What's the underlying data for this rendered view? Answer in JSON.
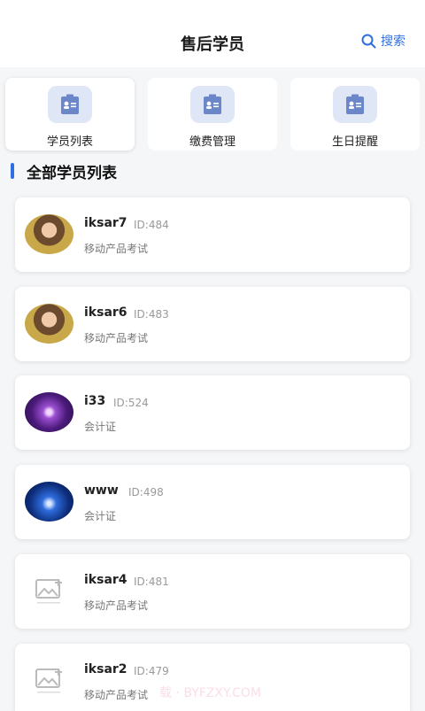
{
  "header": {
    "title": "售后学员",
    "search_label": "搜索"
  },
  "tabs": [
    {
      "label": "学员列表",
      "icon": "student-card-icon",
      "active": true
    },
    {
      "label": "缴费管理",
      "icon": "student-card-icon",
      "active": false
    },
    {
      "label": "生日提醒",
      "icon": "student-card-icon",
      "active": false
    }
  ],
  "section": {
    "title": "全部学员列表"
  },
  "students": [
    {
      "name": "iksar7",
      "id": "ID:484",
      "course": "移动产品考试",
      "avatar": "photo"
    },
    {
      "name": "iksar6",
      "id": "ID:483",
      "course": "移动产品考试",
      "avatar": "photo"
    },
    {
      "name": "i33",
      "id": "ID:524",
      "course": "会计证",
      "avatar": "galaxy"
    },
    {
      "name": "www",
      "id": "ID:498",
      "course": "会计证",
      "avatar": "blue-light"
    },
    {
      "name": "iksar4",
      "id": "ID:481",
      "course": "移动产品考试",
      "avatar": "placeholder"
    },
    {
      "name": "iksar2",
      "id": "ID:479",
      "course": "移动产品考试",
      "avatar": "placeholder"
    }
  ],
  "watermark": "载 · BYFZXY.COM",
  "colors": {
    "accent": "#2f6fe0",
    "icon_bg": "#dfe6f5",
    "icon_fg": "#6b86c9"
  }
}
